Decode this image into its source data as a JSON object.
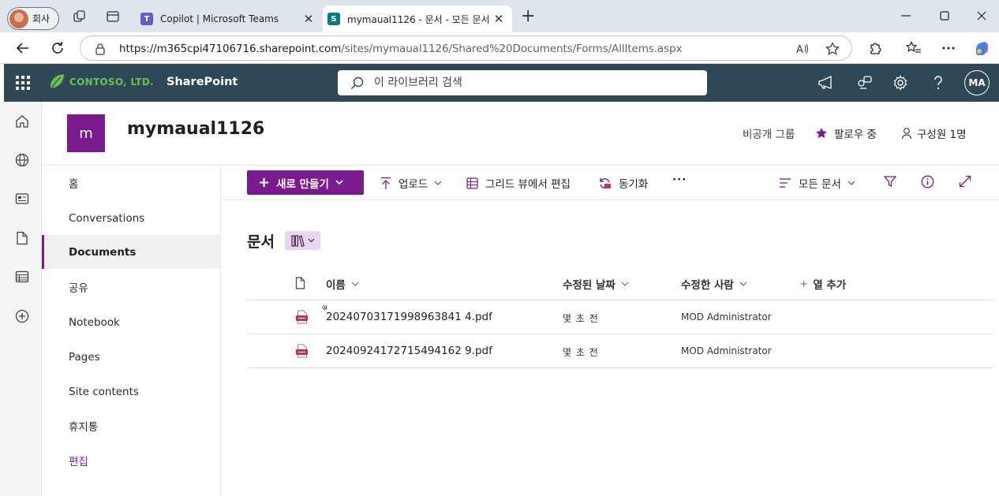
{
  "browser": {
    "profile_label": "회사",
    "tabs": [
      {
        "title": "Copilot | Microsoft Teams",
        "active": false
      },
      {
        "title": "mymaual1126 - 문서 - 모든 문서",
        "active": true
      }
    ],
    "address": {
      "host": "https://m365cpi47106716.sharepoint.com",
      "path": "/sites/mymaual1126/Shared%20Documents/Forms/AllItems.aspx"
    }
  },
  "suite": {
    "org_name": "CONTOSO, LTD.",
    "app_name": "SharePoint",
    "search_placeholder": "이 라이브러리 검색",
    "avatar_initials": "MA"
  },
  "site": {
    "logo_letter": "m",
    "title": "mymaual1126",
    "privacy": "비공개 그룹",
    "follow_label": "팔로우 중",
    "members_label": "구성원 1명"
  },
  "leftnav": {
    "items": [
      {
        "label": "홈",
        "selected": false
      },
      {
        "label": "Conversations",
        "selected": false
      },
      {
        "label": "Documents",
        "selected": true
      },
      {
        "label": "공유",
        "selected": false
      },
      {
        "label": "Notebook",
        "selected": false
      },
      {
        "label": "Pages",
        "selected": false
      },
      {
        "label": "Site contents",
        "selected": false
      },
      {
        "label": "휴지통",
        "selected": false
      },
      {
        "label": "편집",
        "selected": false
      }
    ]
  },
  "commands": {
    "new_label": "새로 만들기",
    "upload_label": "업로드",
    "grid_edit_label": "그리드 뷰에서 편집",
    "sync_label": "동기화",
    "more_label": "···",
    "view_label": "모든 문서"
  },
  "library": {
    "title": "문서",
    "columns": {
      "name": "이름",
      "modified": "수정된 날짜",
      "modified_by": "수정한 사람",
      "add_column": "열 추가"
    },
    "rows": [
      {
        "name": "20240703171998963841 4.pdf",
        "modified": "몇 초 전",
        "modified_by": "MOD Administrator",
        "is_new": true
      },
      {
        "name": "20240924172715494162 9.pdf",
        "modified": "몇 초 전",
        "modified_by": "MOD Administrator",
        "is_new": false
      }
    ]
  },
  "colors": {
    "accent": "#7b1a8f",
    "suitebar": "#2f4858",
    "brand_green": "#6cc24a",
    "pdf_red": "#c4314b"
  }
}
